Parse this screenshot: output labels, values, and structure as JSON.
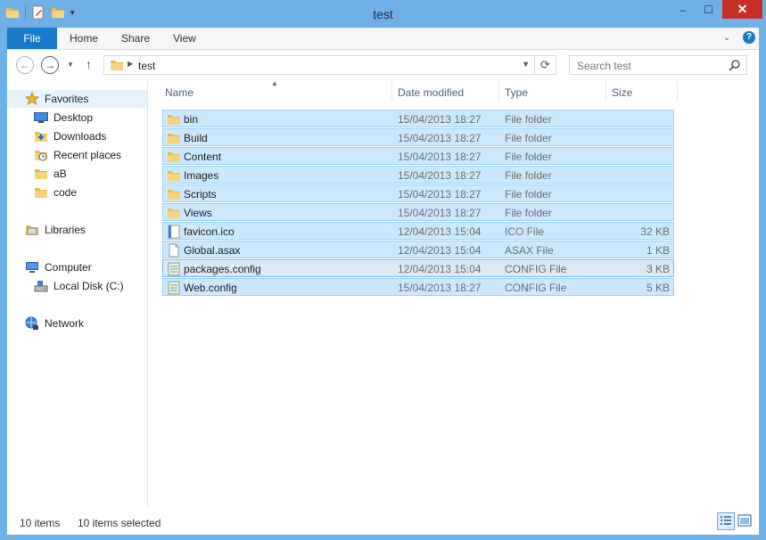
{
  "window": {
    "title": "test",
    "close_glyph": "✕",
    "minimize_glyph": "‒",
    "maximize_glyph": "☐"
  },
  "ribbon": {
    "tabs": [
      "File",
      "Home",
      "Share",
      "View"
    ],
    "help_label": "?"
  },
  "address": {
    "crumb": "test",
    "up_glyph": "↑",
    "refresh_glyph": "⟳"
  },
  "search": {
    "placeholder": "Search test"
  },
  "nav_pane": {
    "favorites": "Favorites",
    "favorite_items": [
      "Desktop",
      "Downloads",
      "Recent places",
      "aB",
      "code"
    ],
    "libraries": "Libraries",
    "computer": "Computer",
    "computer_items": [
      "Local Disk (C:)"
    ],
    "network": "Network"
  },
  "columns": {
    "name": "Name",
    "date": "Date modified",
    "type": "Type",
    "size": "Size"
  },
  "files": [
    {
      "name": "bin",
      "date": "15/04/2013 18:27",
      "type": "File folder",
      "size": "",
      "icon": "folder-icon"
    },
    {
      "name": "Build",
      "date": "15/04/2013 18:27",
      "type": "File folder",
      "size": "",
      "icon": "folder-icon"
    },
    {
      "name": "Content",
      "date": "15/04/2013 18:27",
      "type": "File folder",
      "size": "",
      "icon": "folder-icon"
    },
    {
      "name": "Images",
      "date": "15/04/2013 18:27",
      "type": "File folder",
      "size": "",
      "icon": "folder-icon"
    },
    {
      "name": "Scripts",
      "date": "15/04/2013 18:27",
      "type": "File folder",
      "size": "",
      "icon": "folder-icon"
    },
    {
      "name": "Views",
      "date": "15/04/2013 18:27",
      "type": "File folder",
      "size": "",
      "icon": "folder-icon"
    },
    {
      "name": "favicon.ico",
      "date": "12/04/2013 15:04",
      "type": "ICO File",
      "size": "32 KB",
      "icon": "image-file-icon"
    },
    {
      "name": "Global.asax",
      "date": "12/04/2013 15:04",
      "type": "ASAX File",
      "size": "1 KB",
      "icon": "file-icon"
    },
    {
      "name": "packages.config",
      "date": "12/04/2013 15:04",
      "type": "CONFIG File",
      "size": "3 KB",
      "icon": "config-file-icon"
    },
    {
      "name": "Web.config",
      "date": "15/04/2013 18:27",
      "type": "CONFIG File",
      "size": "5 KB",
      "icon": "config-file-icon"
    }
  ],
  "status": {
    "count": "10 items",
    "selected": "10 items selected"
  },
  "colors": {
    "accent": "#1979ca",
    "selection": "#cce8ff",
    "selection_border": "#99d1ff",
    "close": "#c7302a",
    "frame": "#6fb0e6"
  }
}
